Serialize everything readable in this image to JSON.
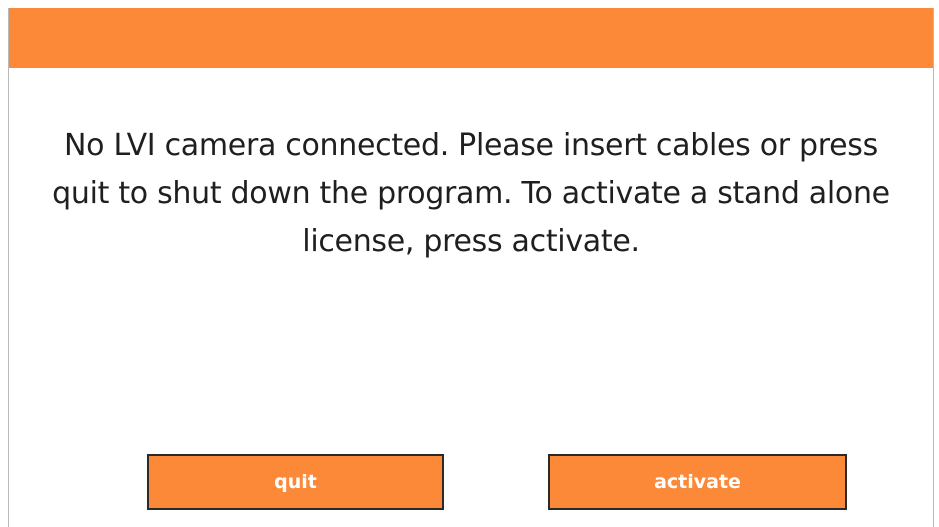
{
  "dialog": {
    "message": "No LVI camera connected. Please insert cables or press quit to shut down the program. To activate a stand alone license, press activate.",
    "buttons": {
      "quit_label": "quit",
      "activate_label": "activate"
    }
  },
  "colors": {
    "accent": "#fb8937",
    "button_border": "#2a2a2a",
    "button_text": "#ffffff",
    "message_text": "#1f1f1f"
  }
}
